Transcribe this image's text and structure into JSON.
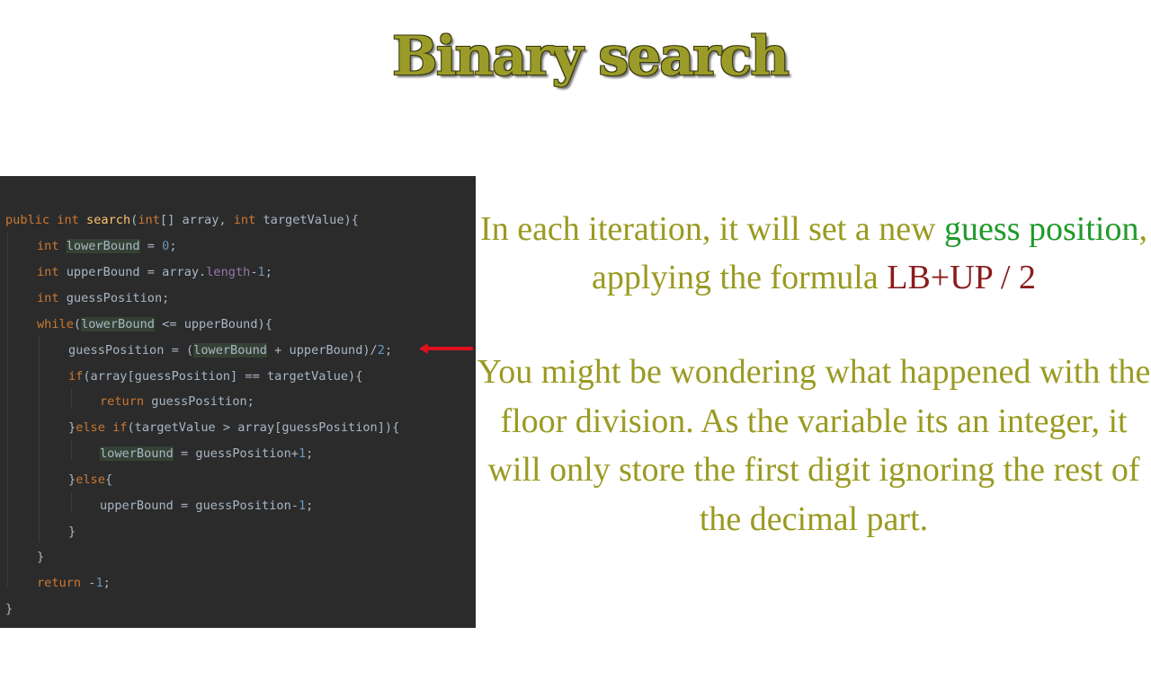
{
  "title": "Binary search",
  "code": {
    "l1": {
      "kw1": "public",
      "kw2": "int",
      "fn": "search",
      "p1": "(",
      "kw3": "int",
      "p2": "[] array, ",
      "kw4": "int",
      "p3": " targetValue){"
    },
    "l2": {
      "kw": "int",
      "sp": " ",
      "var": "lowerBound",
      "eq": " = ",
      "num": "0",
      "end": ";"
    },
    "l3": {
      "kw": "int",
      "rest": " upperBound = array.",
      "prop": "length",
      "op": "-",
      "num": "1",
      "end": ";"
    },
    "l4": {
      "kw": "int",
      "rest": " guessPosition;"
    },
    "l5": {
      "kw": "while",
      "p1": "(",
      "var": "lowerBound",
      "rest": " <= upperBound){"
    },
    "l6": {
      "a": "guessPosition = (",
      "var": "lowerBound",
      "b": " + upperBound)/",
      "num": "2",
      "end": ";"
    },
    "l7": {
      "kw": "if",
      "rest": "(array[guessPosition] == targetValue){"
    },
    "l8": {
      "kw": "return",
      "rest": " guessPosition;"
    },
    "l9": {
      "a": "}",
      "kw1": "else if",
      "rest": "(targetValue > array[guessPosition]){"
    },
    "l10": {
      "var": "lowerBound",
      "rest": " = guessPosition+",
      "num": "1",
      "end": ";"
    },
    "l11": {
      "a": "}",
      "kw": "else",
      "b": "{"
    },
    "l12": {
      "rest": "upperBound = guessPosition-",
      "num": "1",
      "end": ";"
    },
    "l13": "}",
    "l14": "}",
    "l15": {
      "kw": "return",
      "sp": " ",
      "op": "-",
      "num": "1",
      "end": ";"
    },
    "l16": "}"
  },
  "arrow_color": "#e0101e",
  "paragraph1": {
    "a": "In each iteration, it will set a new ",
    "green": "guess position",
    "b": ", applying the formula ",
    "red": "LB+UP / 2"
  },
  "paragraph2": "You might be wondering what happened with the floor division. As the variable its an integer, it will only store the first digit  ignoring the rest of the decimal part.",
  "colors": {
    "text": "#9a9a22",
    "green": "#1f9a2a",
    "red": "#8a1c1c",
    "code_bg": "#2b2b2b"
  }
}
